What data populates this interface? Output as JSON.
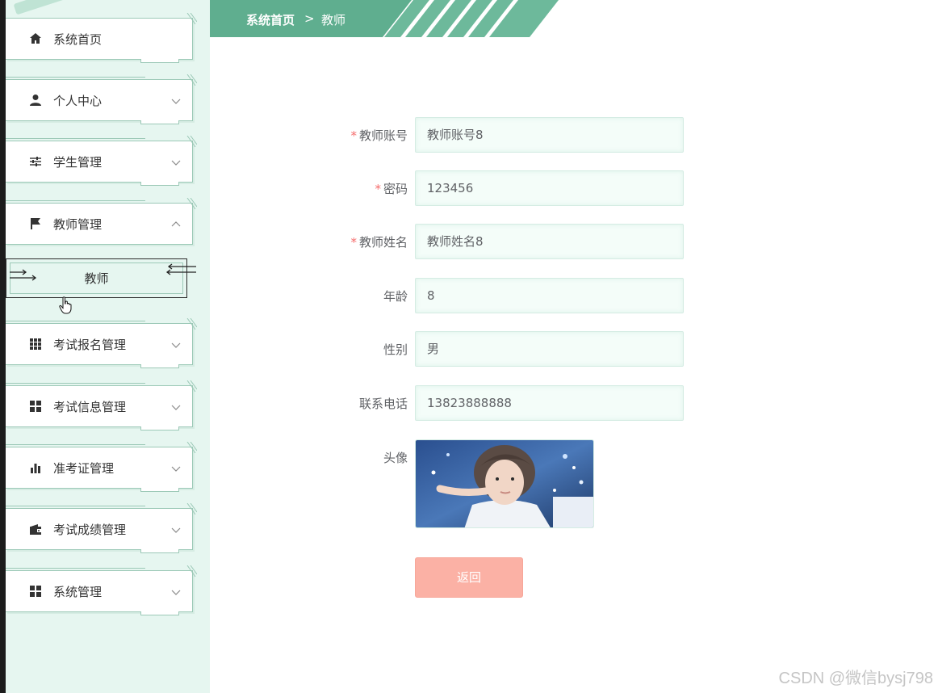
{
  "sidebar": {
    "items": [
      {
        "label": "系统首页",
        "icon": "home-icon",
        "expandable": false
      },
      {
        "label": "个人中心",
        "icon": "user-icon",
        "expandable": true,
        "state": "collapsed"
      },
      {
        "label": "学生管理",
        "icon": "sliders-icon",
        "expandable": true,
        "state": "collapsed"
      },
      {
        "label": "教师管理",
        "icon": "flag-icon",
        "expandable": true,
        "state": "expanded"
      },
      {
        "label": "考试报名管理",
        "icon": "grid-icon",
        "expandable": true,
        "state": "collapsed"
      },
      {
        "label": "考试信息管理",
        "icon": "tiles-icon",
        "expandable": true,
        "state": "collapsed"
      },
      {
        "label": "准考证管理",
        "icon": "bar-chart-icon",
        "expandable": true,
        "state": "collapsed"
      },
      {
        "label": "考试成绩管理",
        "icon": "wallet-icon",
        "expandable": true,
        "state": "collapsed"
      },
      {
        "label": "系统管理",
        "icon": "tiles-icon",
        "expandable": true,
        "state": "collapsed"
      }
    ],
    "submenu": {
      "label": "教师"
    }
  },
  "breadcrumb": {
    "home": "系统首页",
    "separator": ">",
    "current": "教师"
  },
  "form": {
    "fields": [
      {
        "label": "教师账号",
        "required": true,
        "value": "教师账号8"
      },
      {
        "label": "密码",
        "required": true,
        "value": "123456"
      },
      {
        "label": "教师姓名",
        "required": true,
        "value": "教师姓名8"
      },
      {
        "label": "年龄",
        "required": false,
        "value": "8"
      },
      {
        "label": "性别",
        "required": false,
        "value": "男"
      },
      {
        "label": "联系电话",
        "required": false,
        "value": "13823888888"
      }
    ],
    "avatar_label": "头像",
    "return_label": "返回"
  },
  "watermark": "CSDN @微信bysj798",
  "colors": {
    "accent": "#5fae8f",
    "sidebar_bg": "#e6f6f0",
    "return_button": "#fbb1a5",
    "required": "#f56c6c"
  }
}
